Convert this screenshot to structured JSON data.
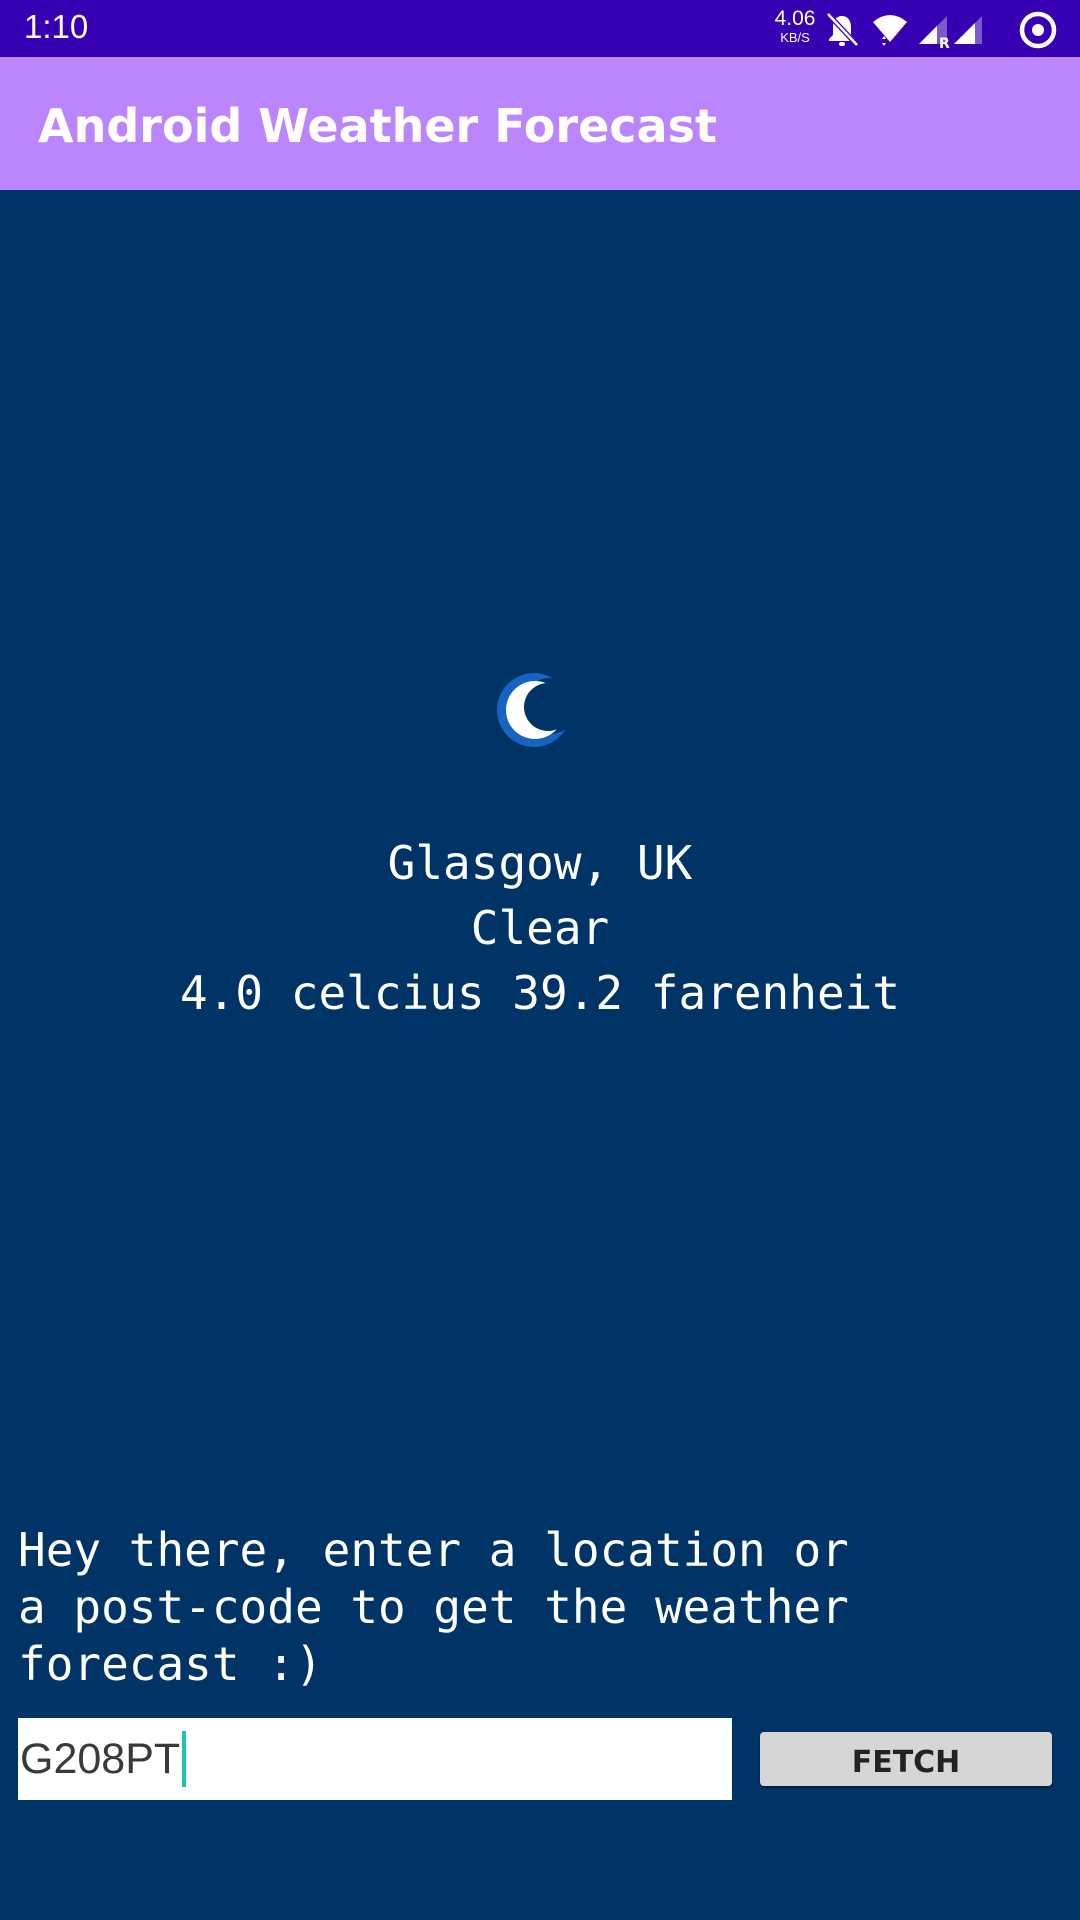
{
  "status_bar": {
    "time": "1:10",
    "net_speed_value": "4.06",
    "net_speed_unit": "KB/S",
    "icons": [
      "bell-off-icon",
      "wifi-icon",
      "signal-roaming-icon",
      "signal-icon",
      "target-icon"
    ],
    "roaming_label": "R"
  },
  "app_bar": {
    "title": "Android Weather Forecast"
  },
  "weather": {
    "icon": "crescent-moon-icon",
    "location": "Glasgow, UK",
    "condition": "Clear",
    "temperature": "4.0 celcius 39.2 farenheit"
  },
  "prompt": {
    "text": "Hey there, enter a location or\na post-code to get the weather\nforecast :)"
  },
  "search": {
    "value": "G208PT"
  },
  "fetch_button": {
    "label": "FETCH"
  },
  "colors": {
    "status_bar": "#3700B3",
    "app_bar": "#BB86FC",
    "background": "#003366",
    "caret": "#1CC3B0",
    "button": "#D6D6D6"
  }
}
